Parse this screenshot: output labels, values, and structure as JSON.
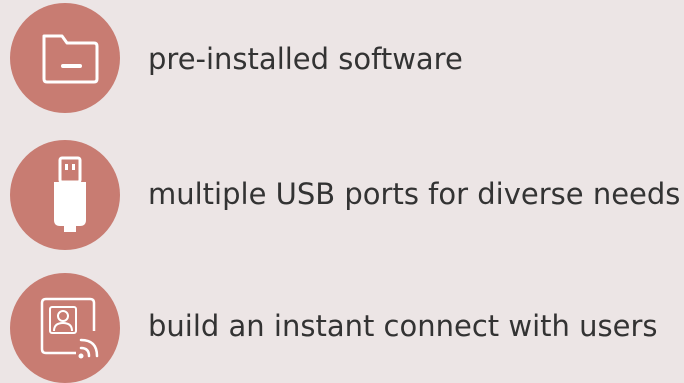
{
  "features": [
    {
      "icon": "folder-icon",
      "label": "pre-installed software"
    },
    {
      "icon": "usb-icon",
      "label": "multiple USB ports for diverse needs"
    },
    {
      "icon": "user-cast-icon",
      "label": "build an instant connect with users"
    }
  ],
  "colors": {
    "background": "#ece5e5",
    "accent": "#c87c72",
    "icon": "#ffffff",
    "text": "#333333"
  }
}
